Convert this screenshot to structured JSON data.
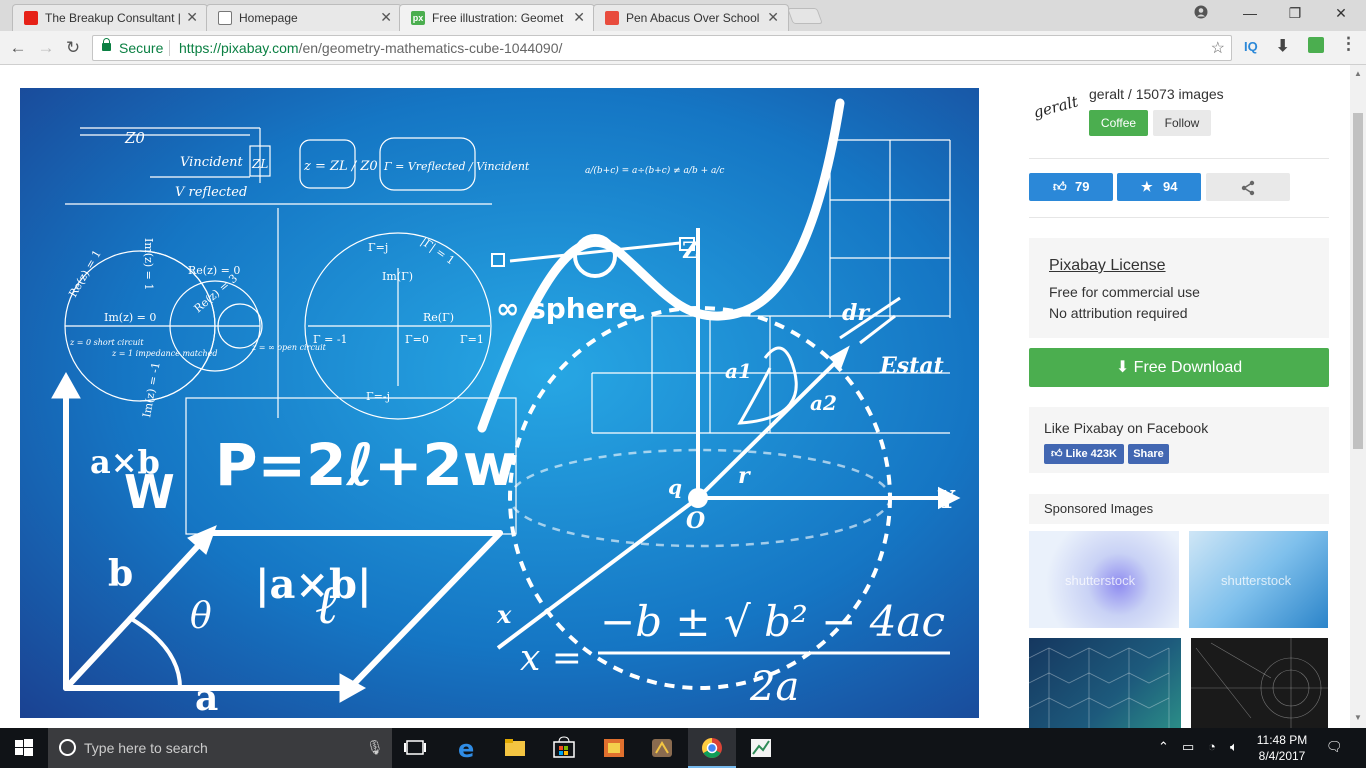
{
  "tabs": [
    {
      "title": "The Breakup Consultant |",
      "icon": "youtube-icon"
    },
    {
      "title": "Homepage",
      "icon": "page-icon"
    },
    {
      "title": "Free illustration: Geomet",
      "icon": "pixabay-icon",
      "active": true
    },
    {
      "title": "Pen Abacus Over School",
      "icon": "site-icon"
    }
  ],
  "address": {
    "secure_label": "Secure",
    "url_host": "https://pixabay.com",
    "url_path": "/en/geometry-mathematics-cube-1044090/"
  },
  "extensions": {
    "iq": "IQ"
  },
  "illustration": {
    "formula_perimeter": "P=2ℓ+2w",
    "formula_area": "a×b",
    "formula_cross": "|a×b|",
    "formula_quadratic_num": "−b ± √ b² − 4ac",
    "formula_quadratic_den": "2a",
    "x_eq": "x =",
    "label_w": "W",
    "label_b": "b",
    "label_a": "a",
    "label_theta": "θ",
    "label_l": "ℓ",
    "label_y": "Y",
    "label_x": "x",
    "label_q": "q",
    "label_o": "O",
    "label_r": "r",
    "label_a1": "a1",
    "label_a2": "a2",
    "label_dr": "dr",
    "label_estat": "Estat",
    "label_inf_sphere": "∞ sphere",
    "label_z": "Z",
    "label_z0": "Z0",
    "label_zl": "ZL",
    "label_vincident": "Vincident",
    "label_vreflected": "V reflected",
    "eq_z": "z = ZL / Z0",
    "eq_gamma": "Γ = Vreflected / Vincident",
    "eq_fraction": "a/(b+c) = a÷(b+c) ≠ a/b + a/c",
    "smith_im1": "Im(z) = 1",
    "smith_re1": "Re(z) = 1",
    "smith_re0": "Re(z) = 0",
    "smith_re3": "Re(z) = 3",
    "smith_im0": "Im(z) = 0",
    "smith_imneg": "Im(z) = -1",
    "smith_short": "z = 0 short circuit",
    "smith_matched": "z = 1 impedance matched",
    "smith_open": "z = ∞ open circuit",
    "gamma_j": "Γ=j",
    "gamma_imag": "Im(Γ)",
    "gamma_real": "Re(Γ)",
    "gamma_neg1": "Γ = -1",
    "gamma_zero": "Γ=0",
    "gamma_one": "Γ=1",
    "gamma_negj": "Γ=-j",
    "gamma_abs": "|Γ| = 1"
  },
  "uploader": {
    "signature": "geralt",
    "name_line": "geralt / 15073 images",
    "coffee_label": "Coffee",
    "follow_label": "Follow"
  },
  "stats": {
    "likes": "79",
    "favorites": "94"
  },
  "license": {
    "title": "Pixabay License",
    "line1": "Free for commercial use",
    "line2": "No attribution required"
  },
  "download": {
    "label": "Free Download"
  },
  "facebook": {
    "title": "Like Pixabay on Facebook",
    "like_label": "Like 423K",
    "share_label": "Share"
  },
  "sponsored": {
    "title": "Sponsored Images",
    "watermark": "shutterstock"
  },
  "taskbar": {
    "search_placeholder": "Type here to search",
    "time": "11:48 PM",
    "date": "8/4/2017"
  },
  "colors": {
    "pixabay_green": "#4bae4f",
    "like_blue": "#2b88d8",
    "secure_green": "#0b8043",
    "facebook_blue": "#4267b2"
  }
}
